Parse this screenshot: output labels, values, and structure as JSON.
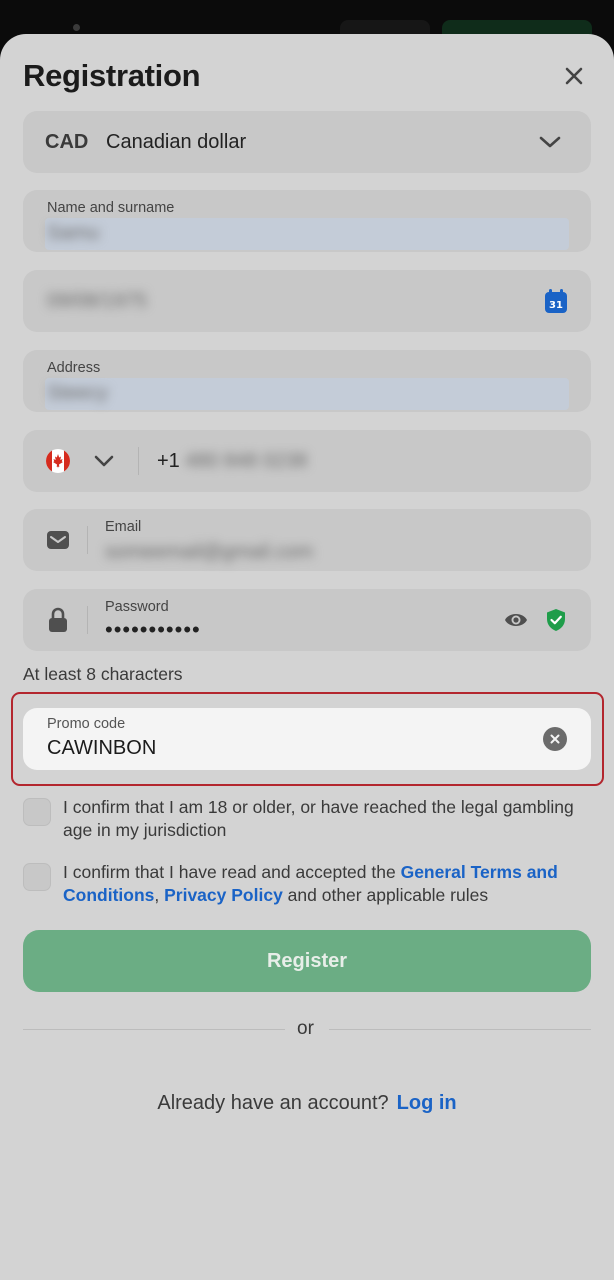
{
  "title": "Registration",
  "currency": {
    "code": "CAD",
    "name": "Canadian dollar"
  },
  "name_field": {
    "label": "Name and surname",
    "value": "Samu"
  },
  "dob_field": {
    "value": "09/08/1975"
  },
  "address_field": {
    "label": "Address",
    "value": "Steecy"
  },
  "phone_field": {
    "country_code": "+1",
    "number": "480 848 0238"
  },
  "email_field": {
    "label": "Email",
    "value": "someemail@gmail.com"
  },
  "password_field": {
    "label": "Password",
    "value": "•••••••••••"
  },
  "password_hint": "At least 8 characters",
  "promo_field": {
    "label": "Promo code",
    "value": "CAWINBON"
  },
  "checks": {
    "age": "I confirm that I am 18 or older, or have reached the legal gambling age in my jurisdiction",
    "terms_prefix": "I confirm that I have read and accepted the ",
    "terms_link": "General Terms and Conditions",
    "terms_sep": ", ",
    "privacy_link": "Privacy Policy",
    "terms_suffix": " and other applicable rules"
  },
  "register_label": "Register",
  "or_label": "or",
  "login_prompt": "Already have an account?",
  "login_link": "Log in",
  "colors": {
    "accent_green": "#6bad84",
    "link_blue": "#1a63c6",
    "highlight_red": "#b3262e",
    "shield_green": "#1f9d4a",
    "calendar_blue": "#1a63c6"
  },
  "icons": [
    "close-icon",
    "chevron-down-icon",
    "calendar-icon",
    "canada-flag-icon",
    "mail-icon",
    "lock-icon",
    "eye-icon",
    "shield-check-icon",
    "clear-icon"
  ]
}
